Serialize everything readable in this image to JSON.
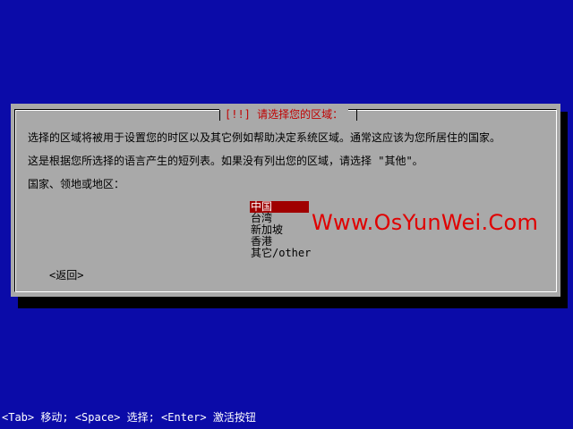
{
  "dialog": {
    "title": "[!!] 请选择您的区域：",
    "message_line1": "选择的区域将被用于设置您的时区以及其它例如帮助决定系统区域。通常这应该为您所居住的国家。",
    "message_line2": "这是根据您所选择的语言产生的短列表。如果没有列出您的区域，请选择 \"其他\"。",
    "prompt": "国家、领地或地区："
  },
  "list": {
    "items": [
      {
        "label": "中国",
        "selected": true
      },
      {
        "label": "台湾",
        "selected": false
      },
      {
        "label": "新加坡",
        "selected": false
      },
      {
        "label": "香港",
        "selected": false
      },
      {
        "label": "其它/other",
        "selected": false
      }
    ]
  },
  "buttons": {
    "back_label": "<返回>"
  },
  "watermark": {
    "text": "Www.OsYunWei.Com"
  },
  "status_bar": {
    "text": "<Tab> 移动; <Space> 选择; <Enter> 激活按钮"
  },
  "colors": {
    "background": "#0b0ba8",
    "dialog": "#a9a9a9",
    "title": "#c00000",
    "selection": "#a00000",
    "watermark": "#e00000"
  }
}
